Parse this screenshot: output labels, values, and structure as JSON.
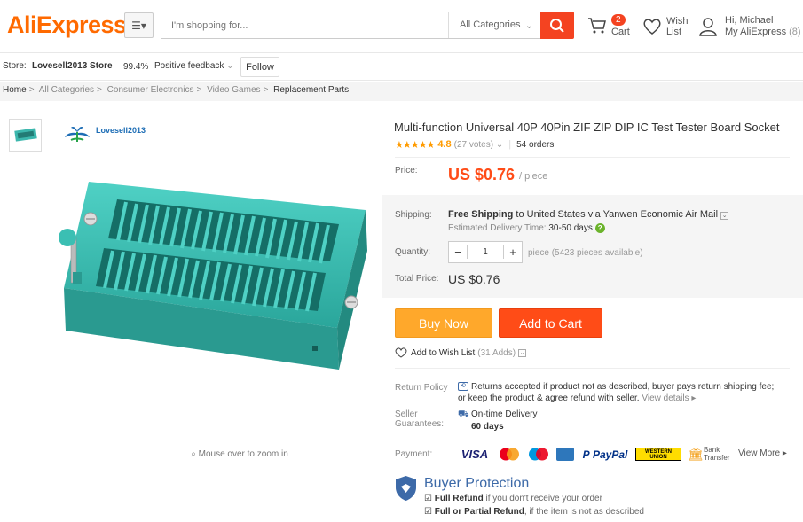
{
  "header": {
    "logo": "AliExpress",
    "search_placeholder": "I'm shopping for...",
    "search_category": "All Categories",
    "cart_count": "2",
    "cart_label": "Cart",
    "wishlist_label_1": "Wish",
    "wishlist_label_2": "List",
    "greeting": "Hi, Michael",
    "account_label": "My AliExpress",
    "account_count": "(8)"
  },
  "store": {
    "prefix": "Store:",
    "name": "Lovesell2013 Store",
    "feedback_pct": "99.4%",
    "feedback_label": "Positive feedback",
    "follow_label": "Follow"
  },
  "breadcrumb": [
    "Home",
    "All Categories",
    "Consumer Electronics",
    "Video Games",
    "Replacement Parts"
  ],
  "gallery": {
    "brand": "Lovesell2013",
    "zoom_hint": "Mouse over to zoom in"
  },
  "product": {
    "title": "Multi-function Universal 40P 40Pin ZIF ZIP DIP IC Test Tester Board Socket",
    "rating": "4.8",
    "rating_stars": 4.8,
    "votes": "(27 votes)",
    "orders": "54 orders",
    "price_label": "Price:",
    "price": "US $0.76",
    "price_unit": "/ piece",
    "shipping_label": "Shipping:",
    "shipping_free": "Free Shipping",
    "shipping_to": "to United States via Yanwen Economic Air Mail",
    "delivery_label": "Estimated Delivery Time:",
    "delivery_days": "30-50 days",
    "quantity_label": "Quantity:",
    "quantity_value": "1",
    "quantity_unit": "piece",
    "pieces_available": "(5423 pieces available)",
    "total_label": "Total Price:",
    "total_price": "US $0.76",
    "buy_now": "Buy Now",
    "add_to_cart": "Add to Cart",
    "wishlist": "Add to Wish List",
    "wishlist_count": "(31 Adds)"
  },
  "policy": {
    "return_label": "Return Policy",
    "return_line1": "Returns accepted if product not as described, buyer pays return shipping fee;",
    "return_line2": "or keep the product & agree refund with seller.",
    "view_details": "View details",
    "seller_label_1": "Seller",
    "seller_label_2": "Guarantees:",
    "ontime": "On-time Delivery",
    "ontime_days": "60 days",
    "payment_label": "Payment:",
    "payments": [
      "VISA",
      "MasterCard",
      "Maestro",
      "Amex",
      "PayPal",
      "WESTERN UNION",
      "Bank Transfer"
    ],
    "view_more": "View More",
    "buyer_protection": "Buyer Protection",
    "full_refund": "Full Refund",
    "full_refund_desc": "if you don't receive your order",
    "partial_refund": "Full or Partial Refund",
    "partial_refund_desc": ", if the item is not as described"
  },
  "colors": {
    "brand_orange": "#ff6a00",
    "price_red": "#ff4c17",
    "buy_now": "#ffa82b",
    "add_to_cart": "#ff4c17",
    "protection_blue": "#3d6aa8"
  }
}
